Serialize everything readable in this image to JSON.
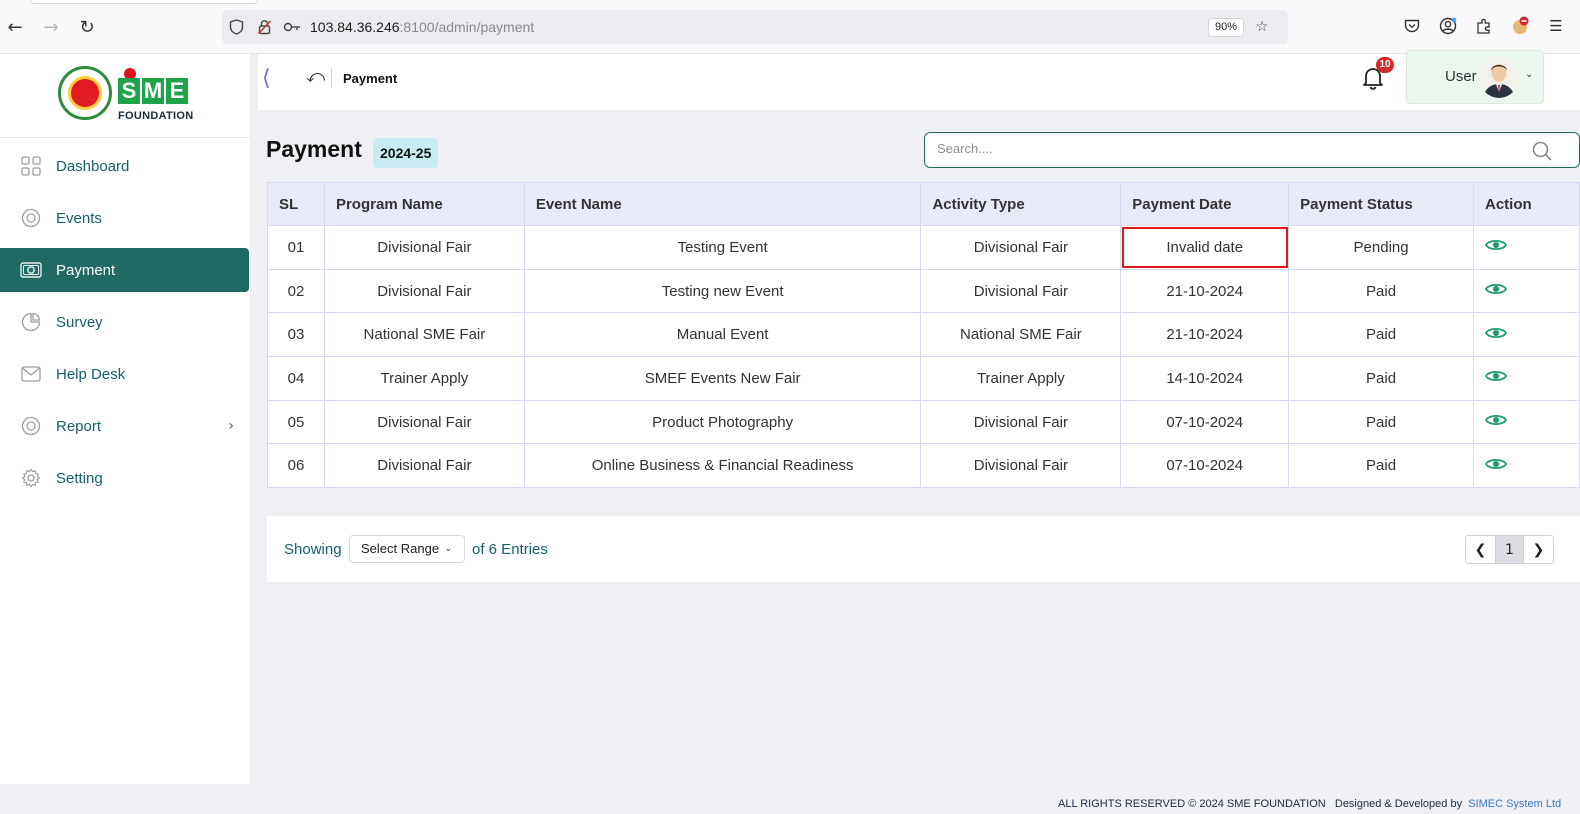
{
  "browser": {
    "url_host": "103.84.36.246",
    "url_rest": ":8100/admin/payment",
    "zoom": "90%"
  },
  "sidebar": {
    "logo_text": "SME",
    "logo_subtext": "FOUNDATION",
    "items": [
      {
        "label": "Dashboard",
        "icon": "dashboard-icon",
        "active": false
      },
      {
        "label": "Events",
        "icon": "events-icon",
        "active": false
      },
      {
        "label": "Payment",
        "icon": "payment-icon",
        "active": true
      },
      {
        "label": "Survey",
        "icon": "survey-icon",
        "active": false
      },
      {
        "label": "Help Desk",
        "icon": "mail-icon",
        "active": false
      },
      {
        "label": "Report",
        "icon": "report-icon",
        "active": false,
        "has_submenu": true
      },
      {
        "label": "Setting",
        "icon": "gear-icon",
        "active": false
      }
    ]
  },
  "topbar": {
    "breadcrumb": "Payment",
    "notification_count": "10",
    "user_name": "User"
  },
  "page": {
    "title": "Payment",
    "year": "2024-25",
    "search_placeholder": "Search...."
  },
  "table": {
    "columns": [
      "SL",
      "Program Name",
      "Event Name",
      "Activity Type",
      "Payment Date",
      "Payment Status",
      "Action"
    ],
    "rows": [
      {
        "sl": "01",
        "program": "Divisional Fair",
        "event": "Testing Event",
        "activity": "Divisional Fair",
        "date": "Invalid date",
        "status": "Pending"
      },
      {
        "sl": "02",
        "program": "Divisional Fair",
        "event": "Testing new Event",
        "activity": "Divisional Fair",
        "date": "21-10-2024",
        "status": "Paid"
      },
      {
        "sl": "03",
        "program": "National SME Fair",
        "event": "Manual Event",
        "activity": "National SME Fair",
        "date": "21-10-2024",
        "status": "Paid"
      },
      {
        "sl": "04",
        "program": "Trainer Apply",
        "event": "SMEF Events New Fair",
        "activity": "Trainer Apply",
        "date": "14-10-2024",
        "status": "Paid"
      },
      {
        "sl": "05",
        "program": "Divisional Fair",
        "event": "Product Photography",
        "activity": "Divisional Fair",
        "date": "07-10-2024",
        "status": "Paid"
      },
      {
        "sl": "06",
        "program": "Divisional Fair",
        "event": "Online Business & Financial Readiness",
        "activity": "Divisional Fair",
        "date": "07-10-2024",
        "status": "Paid"
      }
    ]
  },
  "pagination": {
    "showing_label": "Showing",
    "range_label": "Select Range",
    "entries_label": "of 6 Entries",
    "current_page": "1"
  },
  "footer": {
    "copyright": "ALL RIGHTS RESERVED © 2024 SME FOUNDATION",
    "designed_by": "Designed & Developed by",
    "developer": "SIMEC System Ltd"
  },
  "colors": {
    "primary": "#1f6b63",
    "accent_text": "#17606b",
    "eye_icon": "#1a9b6c",
    "header_bg": "#e8eaf8",
    "highlight_outline": "#e0181e"
  }
}
